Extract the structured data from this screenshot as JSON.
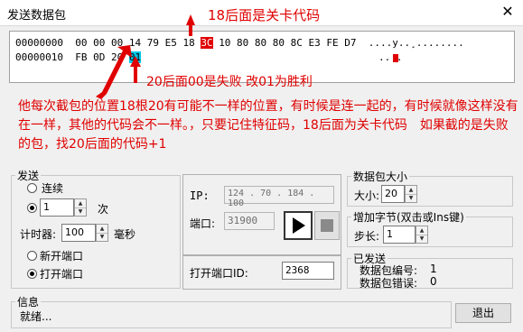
{
  "window": {
    "title": "发送数据包",
    "close_icon": "close-icon"
  },
  "hex": {
    "line1": {
      "addr": "00000000",
      "bytes_a": "00 00 00 14 79 E5 18",
      "hl_byte": "3C",
      "bytes_b": "10 80 80 80 8C E3 FE D7",
      "ascii": "....y..¸........"
    },
    "line2": {
      "addr": "00000010",
      "bytes_a": "FB 0D 20",
      "hl_byte": "01",
      "ascii": ".. ."
    }
  },
  "annotations": {
    "level_code": "18后面是关卡代码",
    "fail_win": "20后面00是失败 改01为胜利",
    "explanation": "他每次截包的位置18根20有可能不一样的位置，有时候是连一起的，有时候就像这样没有在一样，其他的代码会不一样。，只要记住特征码，18后面为关卡代码　如果截的是失败的包，找20后面的代码+1"
  },
  "send": {
    "legend": "发送",
    "continuous_label": "连续",
    "count_value": "1",
    "count_unit": "次",
    "timer_label": "计时器:",
    "timer_value": "100",
    "timer_unit": "毫秒",
    "new_port_label": "新开端口",
    "open_port_label": "打开端口"
  },
  "conn": {
    "ip_label": "IP:",
    "ip_value": "124 . 70 . 184 . 100",
    "port_label": "端口:",
    "port_value": "31900",
    "open_port_id_label": "打开端口ID:",
    "open_port_id_value": "2368"
  },
  "size": {
    "legend": "数据包大小",
    "label": "大小:",
    "value": "20"
  },
  "add": {
    "legend": "增加字节(双击或Ins键)",
    "label": "步长:",
    "value": "1"
  },
  "sent": {
    "legend": "已发送",
    "packet_no_label": "数据包编号:",
    "packet_no_value": "1",
    "error_label": "数据包错误:",
    "error_value": "0"
  },
  "info": {
    "legend": "信息",
    "status": "就绪..."
  },
  "exit_label": "退出",
  "colors": {
    "annotation_red": "#e00000",
    "highlight_cyan": "#00c8e8"
  }
}
